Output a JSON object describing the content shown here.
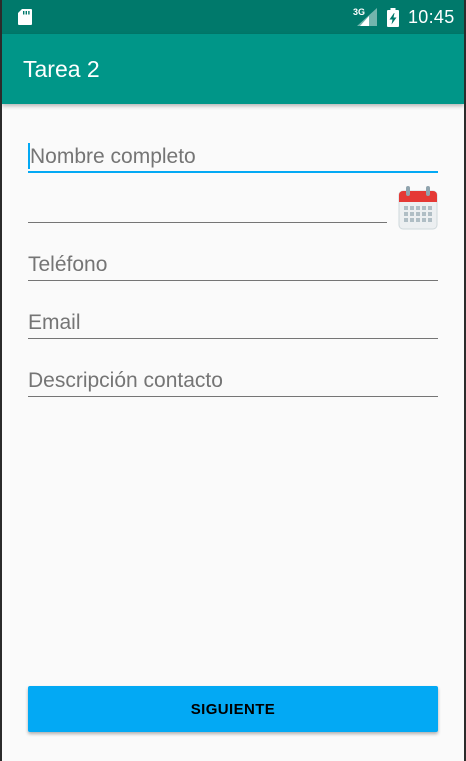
{
  "status_bar": {
    "network": "3G",
    "time": "10:45",
    "icons": [
      "sd-card-icon",
      "signal-icon",
      "battery-charging-icon"
    ]
  },
  "app_bar": {
    "title": "Tarea 2"
  },
  "form": {
    "name_placeholder": "Nombre completo",
    "date_value": "",
    "phone_placeholder": "Teléfono",
    "email_placeholder": "Email",
    "description_placeholder": "Descripción contacto",
    "calendar_icon": "calendar-icon"
  },
  "actions": {
    "next_label": "SIGUIENTE"
  },
  "colors": {
    "status_bar": "#00796b",
    "app_bar": "#009688",
    "accent": "#03a9f4",
    "background": "#fafafa",
    "hint_text": "#757575"
  }
}
